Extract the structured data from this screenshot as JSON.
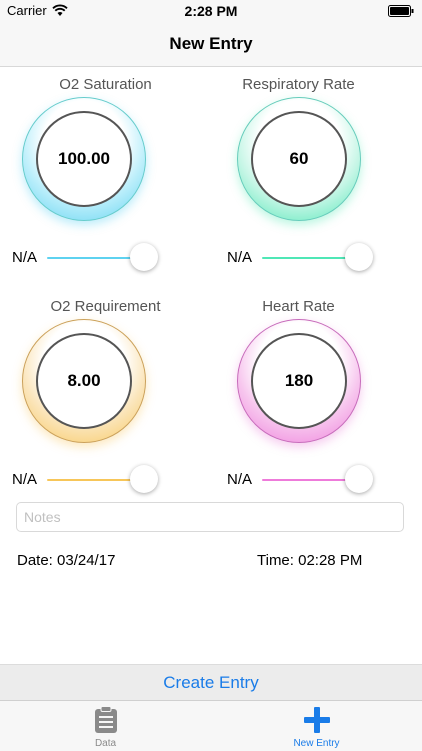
{
  "status": {
    "carrier": "Carrier",
    "time": "2:28 PM"
  },
  "nav": {
    "title": "New Entry"
  },
  "gauges": {
    "o2_saturation": {
      "title": "O2 Saturation",
      "value": "100.00",
      "slider_label": "N/A",
      "slider_level": 1.0,
      "color": "#5ed2f0"
    },
    "respiratory_rate": {
      "title": "Respiratory Rate",
      "value": "60",
      "slider_label": "N/A",
      "slider_level": 1.0,
      "color": "#4fe7b6"
    },
    "o2_requirement": {
      "title": "O2 Requirement",
      "value": "8.00",
      "slider_label": "N/A",
      "slider_level": 1.0,
      "color": "#f7c659"
    },
    "heart_rate": {
      "title": "Heart Rate",
      "value": "180",
      "slider_label": "N/A",
      "slider_level": 1.0,
      "color": "#ee7bda"
    }
  },
  "notes": {
    "placeholder": "Notes"
  },
  "entry": {
    "date": "Date: 03/24/17",
    "time": "Time: 02:28 PM"
  },
  "actions": {
    "create_label": "Create Entry",
    "accent": "#1a7ce8"
  },
  "tabs": [
    {
      "label": "Data",
      "icon": "clipboard-icon",
      "active": false
    },
    {
      "label": "New Entry",
      "icon": "plus-icon",
      "active": true
    }
  ]
}
